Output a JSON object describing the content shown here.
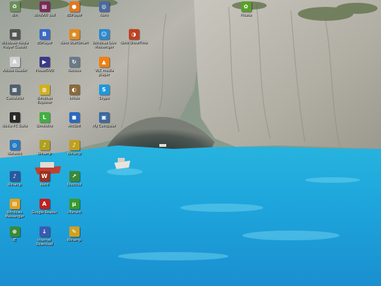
{
  "desktop": {
    "icons": [
      {
        "label": "Bin",
        "icon": "recycle-bin-icon",
        "color": "#6a8f5a"
      },
      {
        "label": "WinRAR Tool",
        "icon": "winrar-icon",
        "color": "#7a2b5c"
      },
      {
        "label": "BSPlayer",
        "icon": "media-player-icon",
        "color": "#e07820"
      },
      {
        "label": "Nero",
        "icon": "nero-icon",
        "color": "#4a6aa0"
      },
      {
        "label": "Picasa",
        "icon": "picasa-icon",
        "color": "#5aa02a"
      },
      {
        "label": "Windows Media Player Classic",
        "icon": "film-icon",
        "color": "#555555"
      },
      {
        "label": "BSPlayer",
        "icon": "bs-player-icon",
        "color": "#3a6ac8"
      },
      {
        "label": "Nero StartSmart",
        "icon": "nero-startsmart-icon",
        "color": "#e08a20"
      },
      {
        "label": "Windows Live Messenger",
        "icon": "messenger-icon",
        "color": "#2a8ad0"
      },
      {
        "label": "Nero ShowTime",
        "icon": "showtime-icon",
        "color": "#c04020"
      },
      {
        "label": "Adobe Reader",
        "icon": "adobe-reader-icon",
        "color": "#d0d0d0"
      },
      {
        "label": "PowerDVD",
        "icon": "dvd-icon",
        "color": "#3a3a8a"
      },
      {
        "label": "Recuva",
        "icon": "recuva-icon",
        "color": "#6a7a8a"
      },
      {
        "label": "VLC media player",
        "icon": "vlc-cone-icon",
        "color": "#f08010"
      },
      {
        "label": "Calculator",
        "icon": "calculator-icon",
        "color": "#506070"
      },
      {
        "label": "Windows Explorer",
        "icon": "explorer-icon",
        "color": "#d0b020"
      },
      {
        "label": "eMule",
        "icon": "emule-icon",
        "color": "#8a6a3a"
      },
      {
        "label": "Skype",
        "icon": "skype-icon",
        "color": "#1a9ae0"
      },
      {
        "label": "Nokia PC Suite",
        "icon": "phone-icon",
        "color": "#2a2a2a"
      },
      {
        "label": "LimeWire",
        "icon": "limewire-icon",
        "color": "#40b040"
      },
      {
        "label": "ArcSoft",
        "icon": "arcsoft-icon",
        "color": "#2a6ac0"
      },
      {
        "label": "My Computer",
        "icon": "my-computer-icon",
        "color": "#3a6aa0"
      },
      {
        "label": "Network",
        "icon": "network-icon",
        "color": "#2a7ac0"
      },
      {
        "label": "Winamp",
        "icon": "winamp-icon",
        "color": "#b0a020"
      },
      {
        "label": "Winamp",
        "icon": "winamp-icon",
        "color": "#c0a020"
      },
      {
        "label": "Winamp",
        "icon": "winamp-icon",
        "color": "#2a5aa0"
      },
      {
        "label": "Word",
        "icon": "word-icon",
        "color": "#a03020"
      },
      {
        "label": "Shortcut",
        "icon": "shortcut-icon",
        "color": "#3a8a3a"
      },
      {
        "label": "Windows Messenger",
        "icon": "windows-icon",
        "color": "#e0a020"
      },
      {
        "label": "Google Reader",
        "icon": "reader-icon",
        "color": "#c02020"
      },
      {
        "label": "uTorrent",
        "icon": "utorrent-icon",
        "color": "#3a9a2a"
      },
      {
        "label": "IE",
        "icon": "network-places-icon",
        "color": "#3a8a3a"
      },
      {
        "label": "Internet Download Manager",
        "icon": "download-icon",
        "color": "#3a5ab0"
      },
      {
        "label": "Winamp",
        "icon": "pencil-icon",
        "color": "#d0a020"
      }
    ],
    "glyphs": {
      "recycle-bin-icon": "♻",
      "winrar-icon": "▤",
      "media-player-icon": "●",
      "nero-icon": "◎",
      "picasa-icon": "✿",
      "film-icon": "▦",
      "bs-player-icon": "B",
      "nero-startsmart-icon": "◉",
      "messenger-icon": "☺",
      "showtime-icon": "◑",
      "adobe-reader-icon": "A",
      "dvd-icon": "▶",
      "recuva-icon": "↻",
      "vlc-cone-icon": "▲",
      "calculator-icon": "▦",
      "explorer-icon": "◍",
      "emule-icon": "◐",
      "skype-icon": "S",
      "phone-icon": "▮",
      "limewire-icon": "L",
      "arcsoft-icon": "◼",
      "my-computer-icon": "▣",
      "network-icon": "◎",
      "winamp-icon": "♪",
      "word-icon": "W",
      "shortcut-icon": "↗",
      "windows-icon": "⊞",
      "reader-icon": "A",
      "utorrent-icon": "µ",
      "network-places-icon": "⊕",
      "download-icon": "↓",
      "pencil-icon": "✎"
    }
  }
}
